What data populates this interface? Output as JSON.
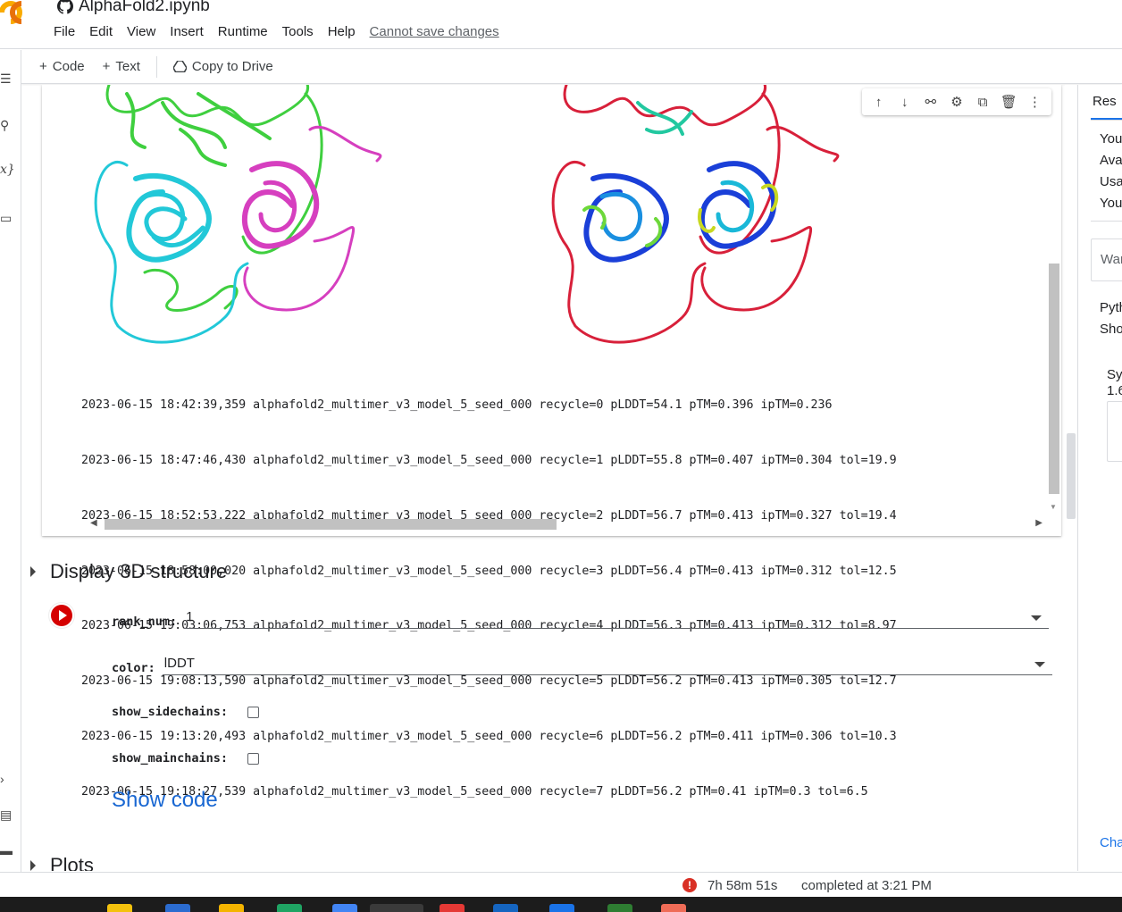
{
  "app": {
    "notebook_title": "AlphaFold2.ipynb",
    "menu": [
      "File",
      "Edit",
      "View",
      "Insert",
      "Runtime",
      "Tools",
      "Help"
    ],
    "cannot_save": "Cannot save changes"
  },
  "toolbar": {
    "code_label": "Code",
    "text_label": "Text",
    "copy_label": "Copy to Drive"
  },
  "output_log": [
    "2023-06-15 18:42:39,359 alphafold2_multimer_v3_model_5_seed_000 recycle=0 pLDDT=54.1 pTM=0.396 ipTM=0.236",
    "2023-06-15 18:47:46,430 alphafold2_multimer_v3_model_5_seed_000 recycle=1 pLDDT=55.8 pTM=0.407 ipTM=0.304 tol=19.9",
    "2023-06-15 18:52:53,222 alphafold2_multimer_v3_model_5_seed_000 recycle=2 pLDDT=56.7 pTM=0.413 ipTM=0.327 tol=19.4",
    "2023-06-15 18:58:00,020 alphafold2_multimer_v3_model_5_seed_000 recycle=3 pLDDT=56.4 pTM=0.413 ipTM=0.312 tol=12.5",
    "2023-06-15 19:03:06,753 alphafold2_multimer_v3_model_5_seed_000 recycle=4 pLDDT=56.3 pTM=0.413 ipTM=0.312 tol=8.97",
    "2023-06-15 19:08:13,590 alphafold2_multimer_v3_model_5_seed_000 recycle=5 pLDDT=56.2 pTM=0.413 ipTM=0.305 tol=12.7",
    "2023-06-15 19:13:20,493 alphafold2_multimer_v3_model_5_seed_000 recycle=6 pLDDT=56.2 pTM=0.411 ipTM=0.306 tol=10.3",
    "2023-06-15 19:18:27,539 alphafold2_multimer_v3_model_5_seed_000 recycle=7 pLDDT=56.2 pTM=0.41 ipTM=0.3 tol=6.5"
  ],
  "display_section": {
    "title": "Display 3D structure",
    "rank_num_label": "rank_num:",
    "rank_num_value": "1",
    "color_label": "color:",
    "color_value": "lDDT",
    "show_sidechains_label": "show_sidechains:",
    "show_mainchains_label": "show_mainchains:",
    "show_code": "Show code"
  },
  "plots_section": {
    "title": "Plots"
  },
  "right_panel": {
    "tab": "Res",
    "lines": [
      "You",
      "Ava",
      "Usa",
      "You"
    ],
    "box_text": "War",
    "lines2": [
      "Pyth",
      "Sho"
    ],
    "sys": [
      "Sy",
      "1.6"
    ],
    "link": "Cha"
  },
  "status": {
    "elapsed": "7h 58m 51s",
    "completed": "completed at 3:21 PM"
  },
  "colors": {
    "chain_a": "#22c8d8",
    "chain_b": "#d63fbf",
    "chain_c": "#3fcf3f",
    "plddt_low": "#d8203a",
    "plddt_high": "#1a3fd8",
    "run_button": "#d50000",
    "link_blue": "#1967d2"
  }
}
